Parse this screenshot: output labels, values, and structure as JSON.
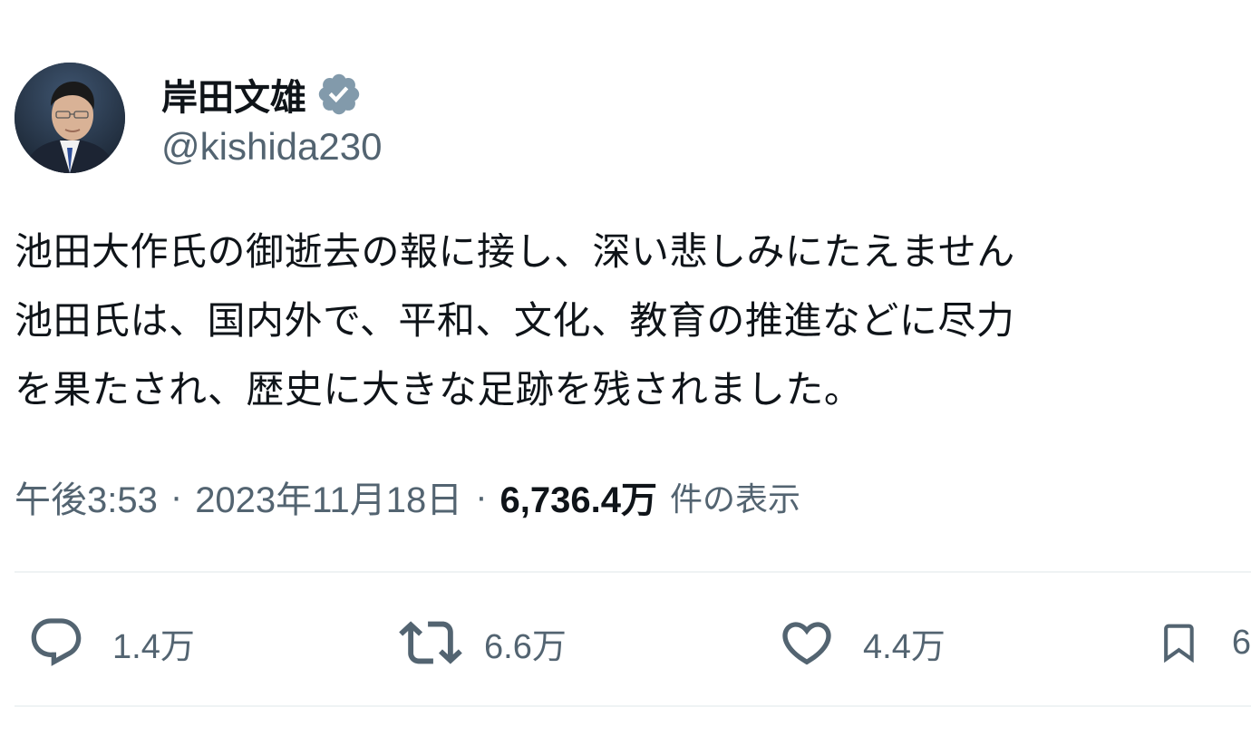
{
  "tweet": {
    "author": {
      "display_name": "岸田文雄",
      "handle": "@kishida230",
      "verified_color": "#829aab"
    },
    "text_lines": [
      "池田大作氏の御逝去の報に接し、深い悲しみにたえません",
      "池田氏は、国内外で、平和、文化、教育の推進などに尽力",
      "を果たされ、歴史に大きな足跡を残されました。"
    ],
    "meta": {
      "time": "午後3:53",
      "separator": "·",
      "date": "2023年11月18日",
      "views_count": "6,736.4万",
      "views_label": "件の表示"
    },
    "actions": {
      "reply": {
        "icon": "reply-icon",
        "count": "1.4万"
      },
      "retweet": {
        "icon": "retweet-icon",
        "count": "6.6万"
      },
      "like": {
        "icon": "heart-icon",
        "count": "4.4万"
      },
      "bookmark": {
        "icon": "bookmark-icon",
        "count": "6"
      }
    },
    "colors": {
      "text_primary": "#0f1419",
      "text_secondary": "#536471",
      "divider": "#eff3f4"
    }
  }
}
